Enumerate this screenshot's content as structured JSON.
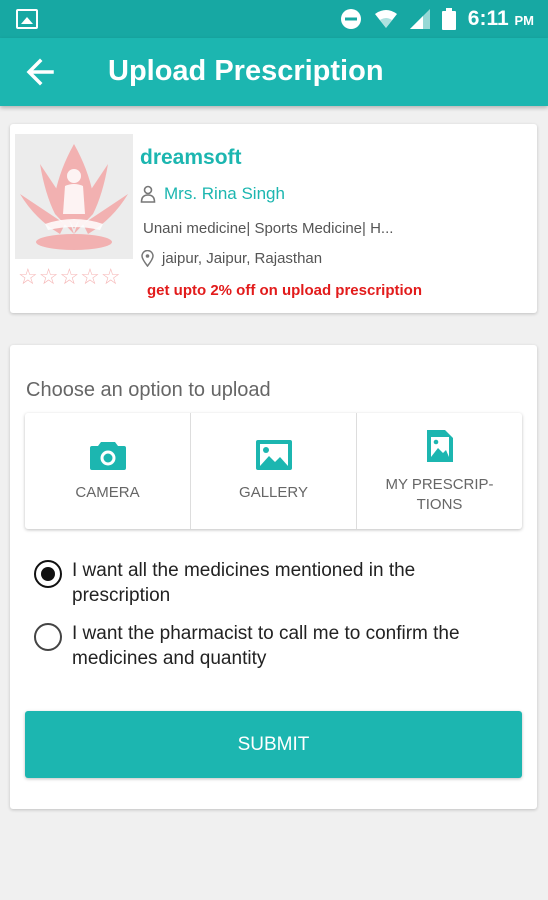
{
  "status_bar": {
    "time": "6:11",
    "ampm": "PM"
  },
  "app_bar": {
    "title": "Upload Prescription"
  },
  "store": {
    "name": "dreamsoft",
    "contact": "Mrs. Rina Singh",
    "specialties": "Unani medicine| Sports Medicine| H...",
    "location": "jaipur, Jaipur, Rajasthan",
    "offer": "get upto 2% off on upload prescription",
    "rating": "☆☆☆☆☆"
  },
  "upload": {
    "choose_label": "Choose an option to upload",
    "options": [
      {
        "label": "CAMERA",
        "icon": "camera-icon"
      },
      {
        "label": "GALLERY",
        "icon": "gallery-icon"
      },
      {
        "label": "MY PRESCRIP-\nTIONS",
        "line1": "MY PRESCRIP-",
        "line2": "TIONS",
        "icon": "prescription-file-icon"
      }
    ],
    "radio_options": [
      {
        "label": "I want all the medicines mentioned in the prescription",
        "selected": true
      },
      {
        "label": "I want the pharmacist to call me to confirm the medicines and quantity",
        "selected": false
      }
    ],
    "submit_label": "SUBMIT"
  },
  "colors": {
    "primary": "#1cb6b0",
    "status_bar": "#17a8a3",
    "offer": "#e21b1b"
  }
}
